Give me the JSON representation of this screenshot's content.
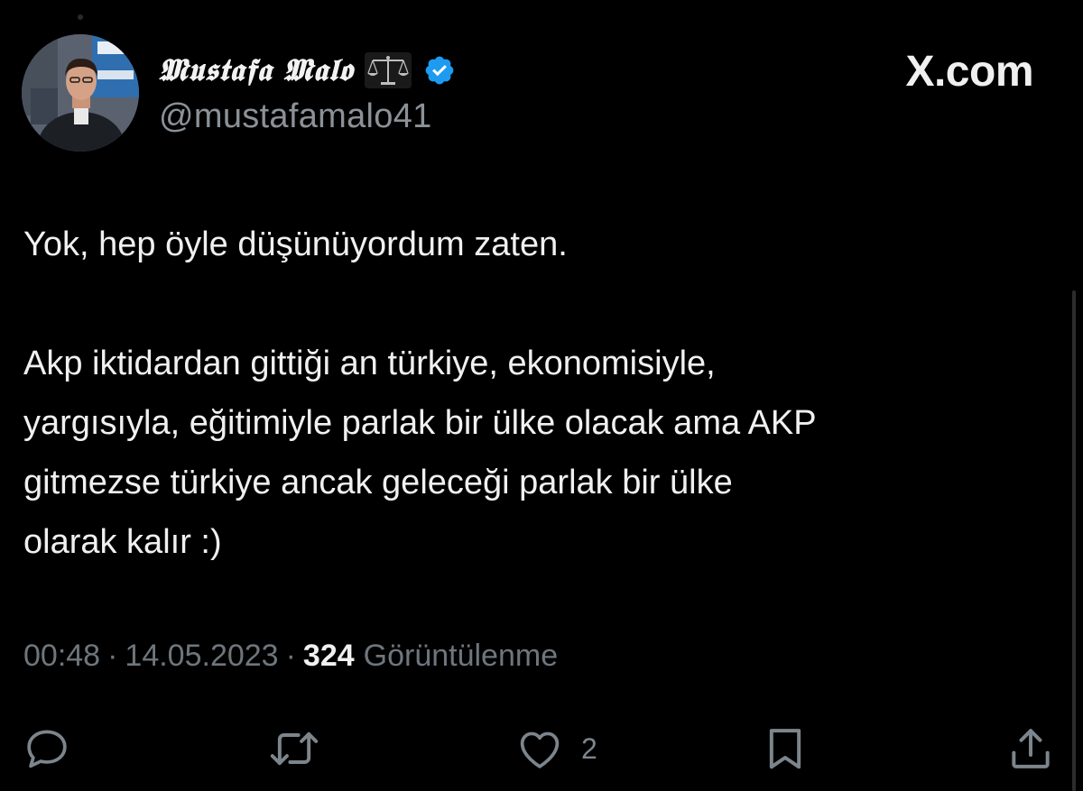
{
  "author": {
    "display_name": "𝕸𝖚𝖘𝖙𝖆𝖋𝖆 𝕸𝖆𝖑𝖔",
    "handle": "@mustafamalo41",
    "avatar_icon": "profile-photo",
    "name_emoji_icon": "balance-scale-icon",
    "verified_icon": "verified-badge-icon"
  },
  "watermark": "X.com",
  "tweet": {
    "lines_first": "Yok, hep öyle düşünüyordum zaten.",
    "lines": [
      "Akp iktidardan gittiği an türkiye, ekonomisiyle,",
      "yargısıyla, eğitimiyle parlak bir ülke olacak ama AKP",
      "gitmezse türkiye ancak geleceği parlak bir ülke",
      "olarak kalır :)"
    ]
  },
  "meta": {
    "time": "00:48",
    "date": "14.05.2023",
    "separator": "·",
    "views_count": "324",
    "views_label": "Görüntülenme"
  },
  "actions": {
    "reply": {
      "icon": "reply-icon"
    },
    "retweet": {
      "icon": "retweet-icon"
    },
    "like": {
      "icon": "heart-icon",
      "count": "2"
    },
    "bookmark": {
      "icon": "bookmark-icon"
    },
    "share": {
      "icon": "share-icon"
    }
  },
  "colors": {
    "background": "#000000",
    "text": "#f0f0f0",
    "muted": "#6e767d",
    "verified": "#1d9bf0"
  }
}
